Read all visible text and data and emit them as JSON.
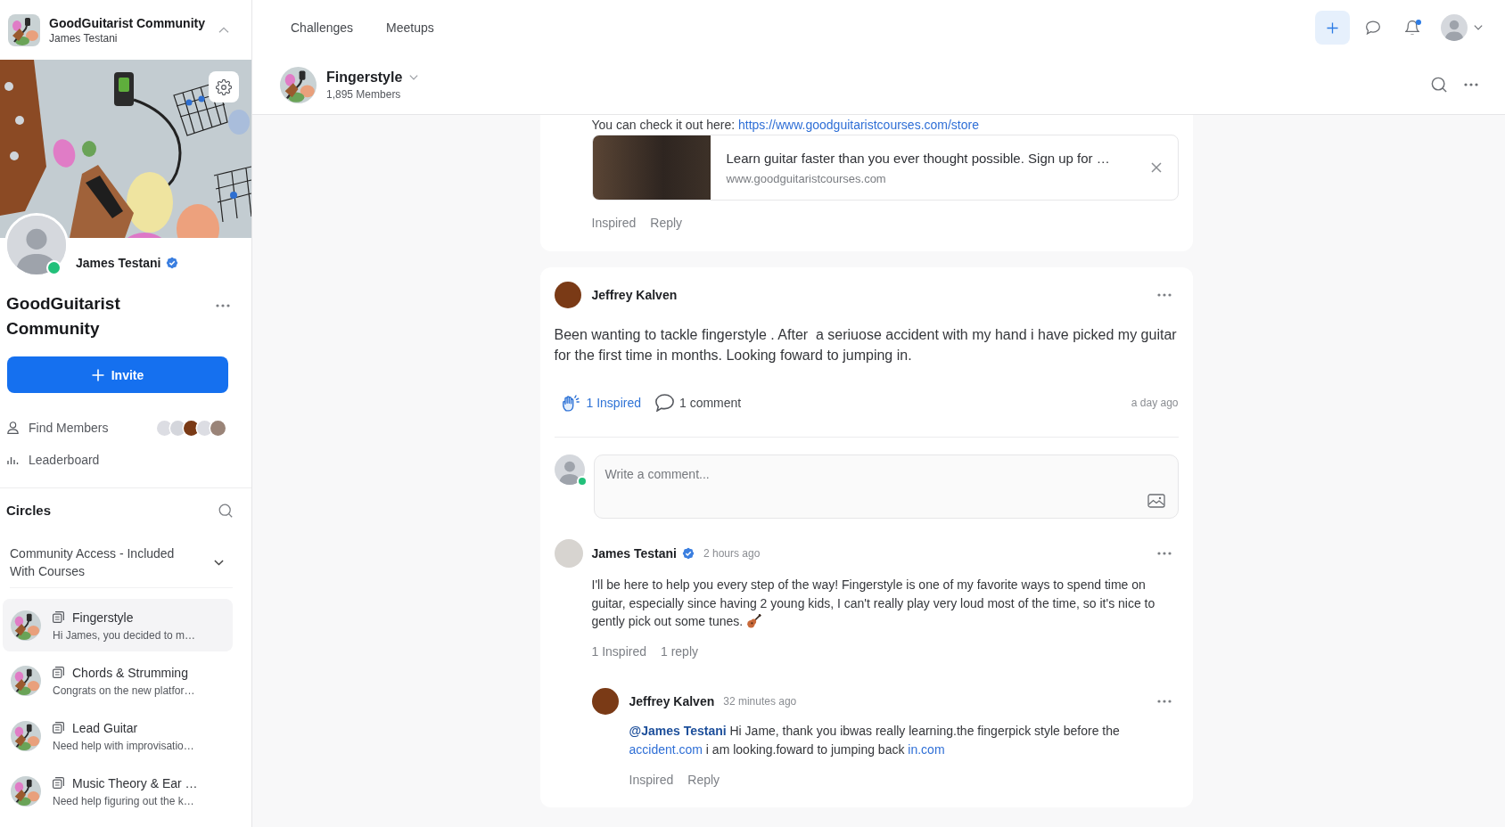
{
  "sidebar": {
    "community": {
      "name": "GoodGuitarist Community",
      "user": "James Testani"
    },
    "profile": {
      "name": "James Testani",
      "verified": true,
      "online": true
    },
    "title": "GoodGuitarist Community",
    "invite_button": "Invite",
    "links": [
      {
        "kind": "members",
        "label": "Find Members",
        "avatars": [
          {
            "color": "#dcdde3"
          },
          {
            "color": "#d4d6dc"
          },
          {
            "color": "#7a3a16"
          },
          {
            "color": "#dcdde3"
          },
          {
            "color": "#9a8478"
          }
        ]
      },
      {
        "kind": "leaderboard",
        "label": "Leaderboard"
      }
    ],
    "circles_heading": "Circles",
    "circle_group": {
      "label": "Community Access - Included With Courses",
      "expanded": true
    },
    "circles": [
      {
        "name": "Fingerstyle",
        "preview": "Hi James, you decided to m…",
        "selected": true
      },
      {
        "name": "Chords & Strumming",
        "preview": "Congrats on the new platfor…",
        "selected": false
      },
      {
        "name": "Lead Guitar",
        "preview": "Need help with improvisatio…",
        "selected": false
      },
      {
        "name": "Music Theory & Ear …",
        "preview": "Need help figuring out the k…",
        "selected": false
      }
    ]
  },
  "topbar": {
    "nav": [
      "Challenges",
      "Meetups"
    ],
    "notifications_unread": true
  },
  "space": {
    "name": "Fingerstyle",
    "members": "1,895 Members"
  },
  "feed": [
    {
      "kind": "continued",
      "text": "You can check it out here: ",
      "link": "https://www.goodguitaristcourses.com/store",
      "preview": {
        "title": "Learn guitar faster than you ever thought possible. Sign up for …",
        "url": "www.goodguitaristcourses.com"
      },
      "inspire": {
        "label": "Inspired",
        "active": false
      },
      "reply": "Reply"
    },
    {
      "kind": "post",
      "author": "Jeffrey Kalven",
      "color": "#7a3a16",
      "body": "Been wanting to tackle fingerstyle . After  a seriuose accident with my hand i have picked my guitar for the first time in months. Looking foward to jumping in.",
      "inspire": {
        "label": "1 Inspired",
        "active": true
      },
      "comment": "1 comment",
      "time": "a day ago",
      "composer": {
        "placeholder": "Write a comment...",
        "online": true
      },
      "comments": [
        {
          "author": "James Testani",
          "color": "#d7d4d0",
          "verified": true,
          "time": "2 hours ago",
          "body": [
            {
              "kind": "text",
              "text": "I'll be here to help you every step of the way! Fingerstyle is one of my favorite ways to spend time on guitar, especially since having 2 young kids, I can't really play very loud most of the time, so it's nice to gently pick out some tunes. "
            },
            {
              "kind": "emoji"
            }
          ],
          "inspire": {
            "label": "1 Inspired",
            "active": false
          },
          "reply": "1 reply",
          "replies": [
            {
              "author": "Jeffrey Kalven",
              "color": "#7a3a16",
              "verified": false,
              "time": "32 minutes ago",
              "body": [
                {
                  "kind": "mention",
                  "text": "@James Testani"
                },
                {
                  "kind": "text",
                  "text": " Hi Jame, thank you ibwas really learning.the fingerpick style before the "
                },
                {
                  "kind": "link",
                  "text": "accident.com"
                },
                {
                  "kind": "text",
                  "text": " i am looking.foward to jumping back "
                },
                {
                  "kind": "link",
                  "text": "in.com"
                }
              ],
              "inspire": {
                "label": "Inspired",
                "active": false
              },
              "reply": "Reply"
            }
          ]
        }
      ]
    }
  ]
}
